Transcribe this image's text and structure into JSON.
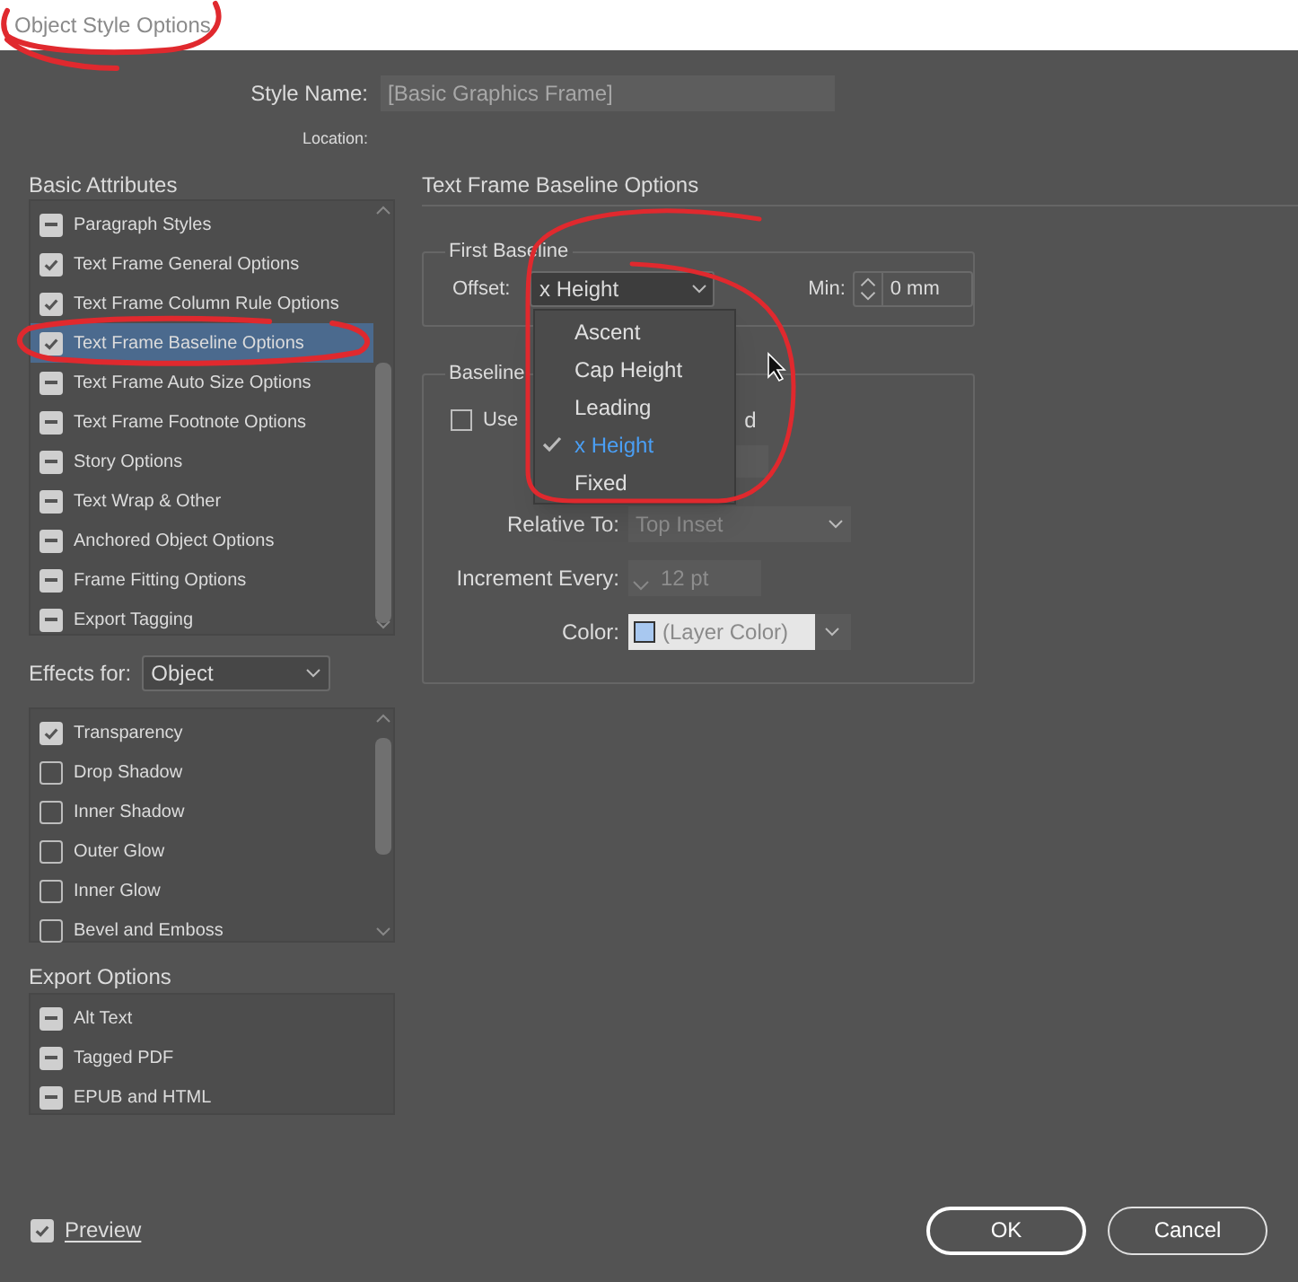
{
  "window": {
    "title": "Object Style Options"
  },
  "style_name": {
    "label": "Style Name:",
    "value": "[Basic Graphics Frame]"
  },
  "location": {
    "label": "Location:"
  },
  "basic_attributes": {
    "heading": "Basic Attributes",
    "items": [
      {
        "label": "Paragraph Styles",
        "checked": true,
        "mixed": true,
        "selected": false
      },
      {
        "label": "Text Frame General Options",
        "checked": true,
        "mixed": false,
        "selected": false
      },
      {
        "label": "Text Frame Column Rule Options",
        "checked": true,
        "mixed": false,
        "selected": false
      },
      {
        "label": "Text Frame Baseline Options",
        "checked": true,
        "mixed": false,
        "selected": true
      },
      {
        "label": "Text Frame Auto Size Options",
        "checked": true,
        "mixed": true,
        "selected": false
      },
      {
        "label": "Text Frame Footnote Options",
        "checked": true,
        "mixed": true,
        "selected": false
      },
      {
        "label": "Story Options",
        "checked": true,
        "mixed": true,
        "selected": false
      },
      {
        "label": "Text Wrap & Other",
        "checked": true,
        "mixed": true,
        "selected": false
      },
      {
        "label": "Anchored Object Options",
        "checked": true,
        "mixed": true,
        "selected": false
      },
      {
        "label": "Frame Fitting Options",
        "checked": true,
        "mixed": true,
        "selected": false
      },
      {
        "label": "Export Tagging",
        "checked": true,
        "mixed": true,
        "selected": false
      }
    ]
  },
  "effects_for": {
    "label": "Effects for:",
    "value": "Object",
    "items": [
      {
        "label": "Transparency",
        "checked": true
      },
      {
        "label": "Drop Shadow",
        "checked": false
      },
      {
        "label": "Inner Shadow",
        "checked": false
      },
      {
        "label": "Outer Glow",
        "checked": false
      },
      {
        "label": "Inner Glow",
        "checked": false
      },
      {
        "label": "Bevel and Emboss",
        "checked": false
      }
    ]
  },
  "export_options": {
    "heading": "Export Options",
    "items": [
      {
        "label": "Alt Text",
        "checked": true,
        "mixed": true
      },
      {
        "label": "Tagged PDF",
        "checked": true,
        "mixed": true
      },
      {
        "label": "EPUB and HTML",
        "checked": true,
        "mixed": true
      }
    ]
  },
  "panel": {
    "heading": "Text Frame Baseline Options",
    "first_baseline": {
      "legend": "First Baseline",
      "offset_label": "Offset:",
      "offset_value": "x Height",
      "min_label": "Min:",
      "min_value": "0 mm",
      "menu": [
        {
          "label": "Ascent",
          "selected": false
        },
        {
          "label": "Cap Height",
          "selected": false
        },
        {
          "label": "Leading",
          "selected": false
        },
        {
          "label": "x Height",
          "selected": true
        },
        {
          "label": "Fixed",
          "selected": false
        }
      ]
    },
    "baseline_grid": {
      "legend": "Baseline",
      "use_label": "Use",
      "use_label_tail": "d",
      "use_checked": false,
      "relative_label": "Relative To:",
      "relative_value": "Top Inset",
      "increment_label": "Increment Every:",
      "increment_value": "12 pt",
      "color_label": "Color:",
      "color_value": "(Layer Color)",
      "color": "#a8c8f0"
    }
  },
  "preview": {
    "label": "Preview",
    "checked": true
  },
  "buttons": [
    {
      "label": "OK",
      "kind": "default"
    },
    {
      "label": "Cancel",
      "kind": "normal"
    }
  ]
}
